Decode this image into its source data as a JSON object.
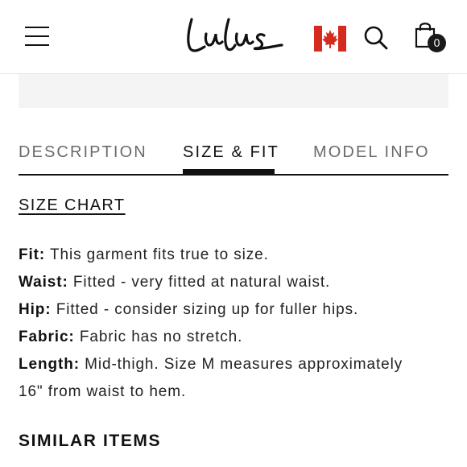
{
  "header": {
    "logo_text": "Lulus",
    "cart_count": "0"
  },
  "tabs": [
    {
      "label": "DESCRIPTION"
    },
    {
      "label": "SIZE & FIT"
    },
    {
      "label": "MODEL INFO"
    }
  ],
  "size_chart_label": "SIZE CHART",
  "details": [
    {
      "label": "Fit:",
      "text": "This garment fits true to size."
    },
    {
      "label": "Waist:",
      "text": "Fitted - very fitted at natural waist."
    },
    {
      "label": "Hip:",
      "text": "Fitted - consider sizing up for fuller hips."
    },
    {
      "label": "Fabric:",
      "text": "Fabric has no stretch."
    },
    {
      "label": "Length:",
      "text": "Mid-thigh. Size M measures approximately"
    },
    {
      "label": "",
      "text": "16\" from waist to hem."
    }
  ],
  "similar_items_title": "SIMILAR ITEMS",
  "colors": {
    "text": "#111111",
    "inactive_tab": "#6b6b6b",
    "flag_red": "#d52b1e"
  },
  "icons": [
    "menu-icon",
    "canada-flag-icon",
    "search-icon",
    "shopping-bag-icon"
  ]
}
